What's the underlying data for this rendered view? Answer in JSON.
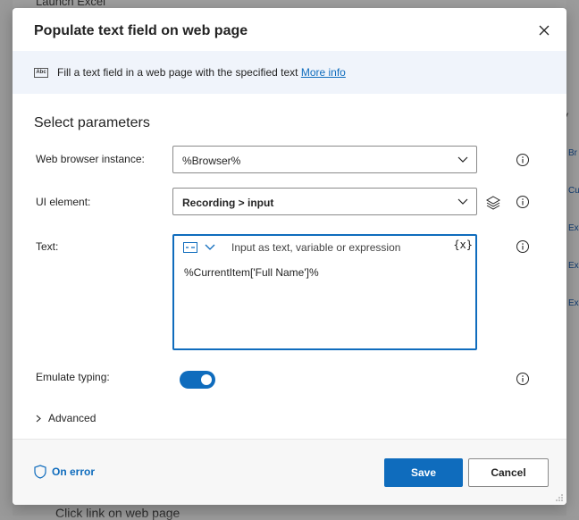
{
  "background": {
    "top_text": "Launch Excel",
    "bottom_text": "Click link on web page",
    "right_header": "V",
    "right_items": [
      "Br",
      "Cu",
      "Ex",
      "Ex",
      "Ex"
    ]
  },
  "dialog": {
    "title": "Populate text field on web page",
    "banner": {
      "icon_text": "Abc",
      "text": "Fill a text field in a web page with the specified text",
      "link": "More info"
    },
    "section_title": "Select parameters",
    "fields": {
      "browser": {
        "label": "Web browser instance:",
        "value": "%Browser%"
      },
      "ui_element": {
        "label": "UI element:",
        "value": "Recording > input"
      },
      "text": {
        "label": "Text:",
        "hint": "Input as text, variable or expression",
        "var_button": "{x}",
        "value": "%CurrentItem['Full Name']%"
      },
      "emulate": {
        "label": "Emulate typing:",
        "on": true
      }
    },
    "advanced_label": "Advanced",
    "footer": {
      "on_error": "On error",
      "save": "Save",
      "cancel": "Cancel"
    }
  },
  "colors": {
    "accent": "#0f6cbd",
    "banner_bg": "#f0f4fb",
    "footer_bg": "#f7f7f7"
  }
}
